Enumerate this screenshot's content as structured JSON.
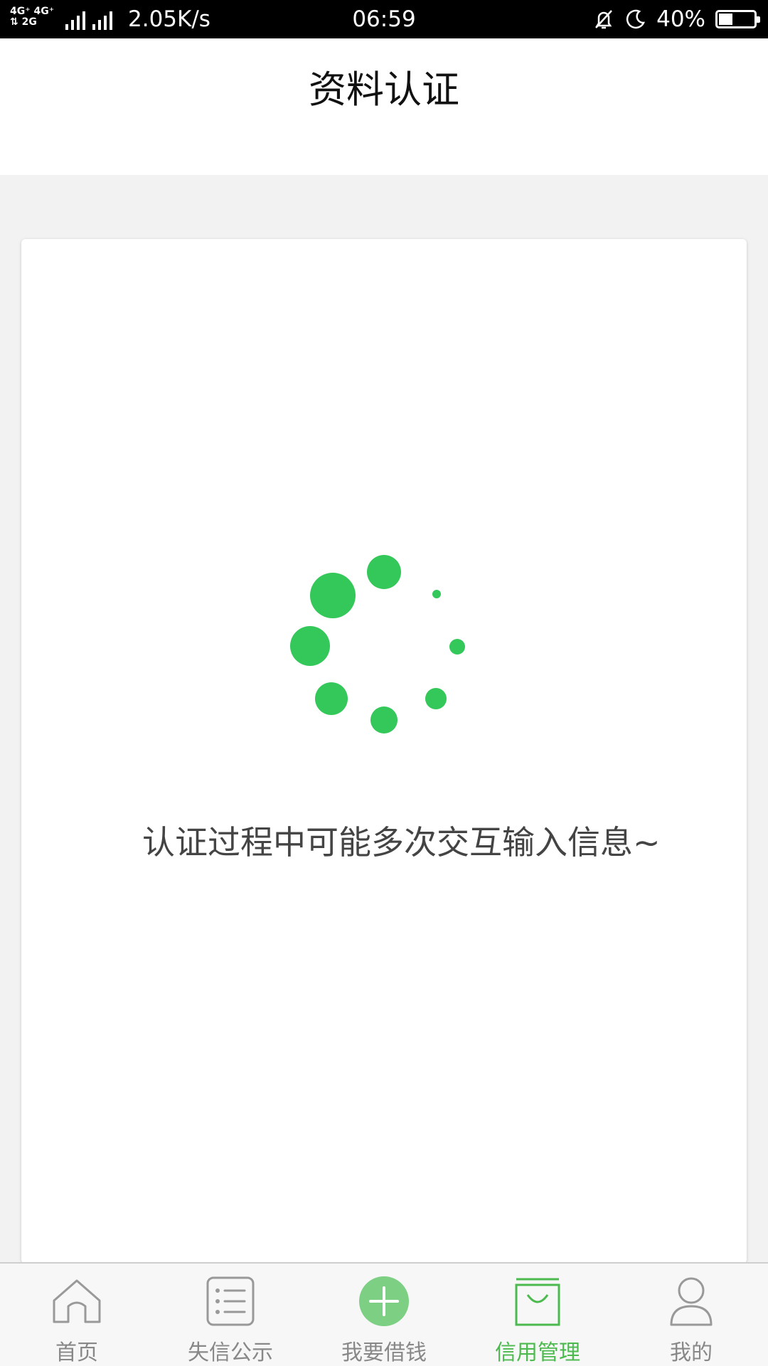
{
  "status_bar": {
    "network_line1": "4G⁺ 4G⁺",
    "network_line2": "⇅ 2G",
    "network_small": "2G",
    "speed": "2.05K/s",
    "time": "06:59",
    "battery": "40%",
    "battery_level": 0.4,
    "icons": [
      "bell-off-icon",
      "moon-icon",
      "battery-icon"
    ]
  },
  "header": {
    "title": "资料认证"
  },
  "card": {
    "loading_text": "认证过程中可能多次交互输入信息~",
    "spinner_color": "#34c759"
  },
  "tabbar": {
    "accent_color": "#4cba4f",
    "items": [
      {
        "label": "首页",
        "icon": "home-icon",
        "active": false
      },
      {
        "label": "失信公示",
        "icon": "list-icon",
        "active": false
      },
      {
        "label": "我要借钱",
        "icon": "plus-circle-icon",
        "active": false
      },
      {
        "label": "信用管理",
        "icon": "bag-icon",
        "active": true
      },
      {
        "label": "我的",
        "icon": "user-icon",
        "active": false
      }
    ]
  }
}
